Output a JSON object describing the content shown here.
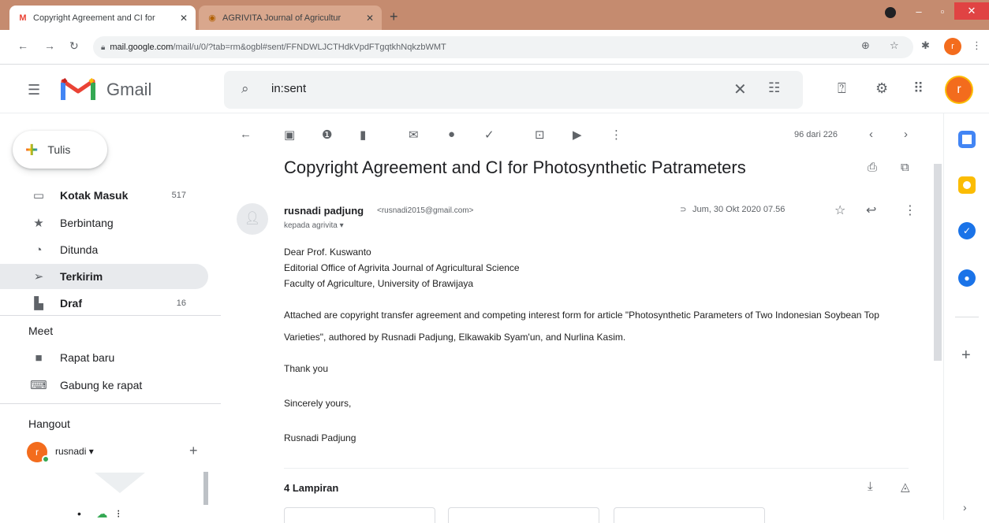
{
  "browser": {
    "tabs": [
      {
        "favicon": "gmail-icon",
        "title": "Copyright Agreement and CI for"
      },
      {
        "favicon": "agrivita-icon",
        "title": "AGRIVITA Journal of Agricultur"
      }
    ],
    "url_domain": "mail.google.com",
    "url_path": "/mail/u/0/?tab=rm&ogbl#sent/FFNDWLJCTHdkVpdFTgqtkhNqkzbWMT",
    "profile_initial": "r"
  },
  "gmail": {
    "logo_text": "Gmail",
    "search": {
      "value": "in:sent"
    },
    "account_initial": "r"
  },
  "sidebar": {
    "compose_label": "Tulis",
    "items": [
      {
        "label": "Kotak Masuk",
        "count": "517",
        "icon": "inbox-icon"
      },
      {
        "label": "Berbintang",
        "count": "",
        "icon": "star-icon"
      },
      {
        "label": "Ditunda",
        "count": "",
        "icon": "clock-icon"
      },
      {
        "label": "Terkirim",
        "count": "",
        "icon": "send-icon"
      },
      {
        "label": "Draf",
        "count": "16",
        "icon": "draft-icon"
      }
    ],
    "meet": {
      "title": "Meet",
      "items": [
        {
          "label": "Rapat baru",
          "icon": "video-icon"
        },
        {
          "label": "Gabung ke rapat",
          "icon": "keyboard-icon"
        }
      ]
    },
    "hangout": {
      "title": "Hangout",
      "user": "rusnadi",
      "avatar_initial": "r"
    }
  },
  "main": {
    "pager": "96 dari 226",
    "subject": "Copyright Agreement and CI for Photosynthetic Patrameters",
    "sender_name": "rusnadi padjung",
    "sender_email": "<rusnadi2015@gmail.com>",
    "recipient": "kepada agrivita",
    "date": "Jum, 30 Okt 2020 07.56",
    "body": {
      "greeting": "Dear Prof. Kuswanto",
      "line2": "Editorial Office of Agrivita Journal of Agricultural Science",
      "line3": "Faculty of Agriculture, University of Brawijaya",
      "paragraph": "Attached are copyright transfer agreement and competing interest form for article  \"Photosynthetic Parameters of Two Indonesian Soybean Top Varieties\", authored by Rusnadi Padjung, Elkawakib Syam'un, and Nurlina Kasim.",
      "thanks": "Thank you",
      "closing": "Sincerely yours,",
      "signature": "Rusnadi Padjung"
    },
    "attachments_title": "4 Lampiran"
  },
  "colors": {
    "titlebar": "#c58b6f",
    "avatar": "#f36c1d",
    "active_nav": "#e8eaed"
  }
}
